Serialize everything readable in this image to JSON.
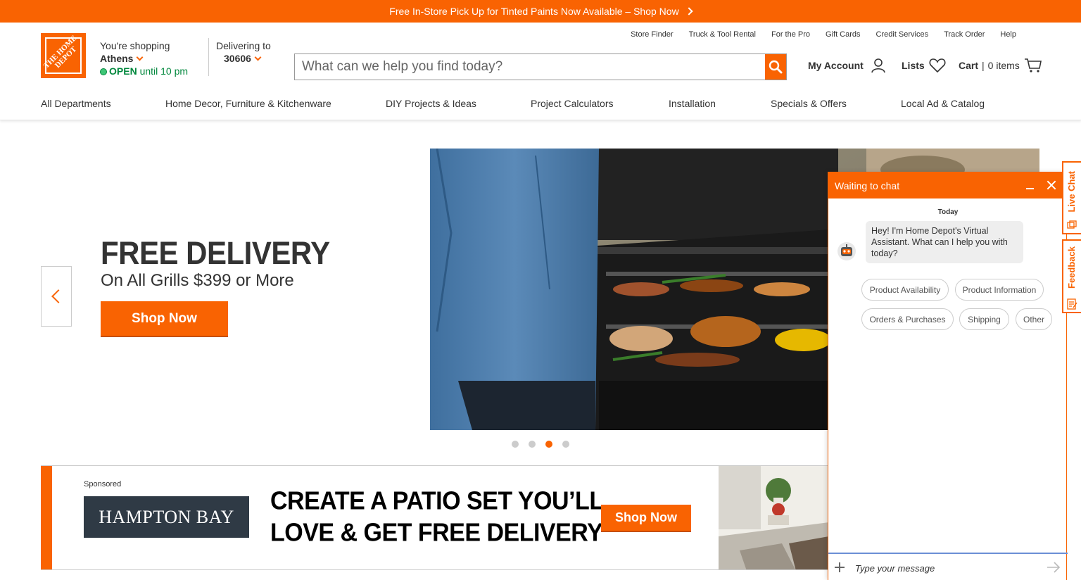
{
  "promo": {
    "text": "Free In-Store Pick Up for Tinted Paints Now Available – Shop Now"
  },
  "logo": {
    "text": "THE HOME DEPOT"
  },
  "store": {
    "label": "You're shopping",
    "city": "Athens",
    "status": "OPEN",
    "hours": "until 10 pm"
  },
  "delivery": {
    "label": "Delivering to",
    "zip": "30606"
  },
  "utility_links": [
    "Store Finder",
    "Truck & Tool Rental",
    "For the Pro",
    "Gift Cards",
    "Credit Services",
    "Track Order",
    "Help"
  ],
  "search": {
    "placeholder": "What can we help you find today?"
  },
  "account": {
    "label": "My Account"
  },
  "lists": {
    "label": "Lists"
  },
  "cart": {
    "label": "Cart",
    "count_text": "0 items"
  },
  "nav": [
    "All Departments",
    "Home Decor, Furniture & Kitchenware",
    "DIY Projects & Ideas",
    "Project Calculators",
    "Installation",
    "Specials & Offers",
    "Local Ad & Catalog"
  ],
  "hero": {
    "title": "FREE DELIVERY",
    "subtitle": "On All Grills $399 or More",
    "button": "Shop Now",
    "slide_count": 4,
    "active_slide": 3
  },
  "sponsored": {
    "label": "Sponsored",
    "brand": "HAMPTON BAY",
    "headline_line1": "CREATE A PATIO SET YOU’LL",
    "headline_line2": "LOVE & GET FREE DELIVERY",
    "button": "Shop Now"
  },
  "chat": {
    "title": "Waiting to chat",
    "day": "Today",
    "message": "Hey! I'm Home Depot's Virtual Assistant. What can I help you with today?",
    "options": [
      "Product Availability",
      "Product Information",
      "Orders & Purchases",
      "Shipping",
      "Other"
    ],
    "input_placeholder": "Type your message"
  },
  "side_tabs": {
    "live_chat": "Live Chat",
    "feedback": "Feedback"
  },
  "colors": {
    "brand": "#f96302",
    "open_green": "#00873c",
    "text": "#333333"
  }
}
